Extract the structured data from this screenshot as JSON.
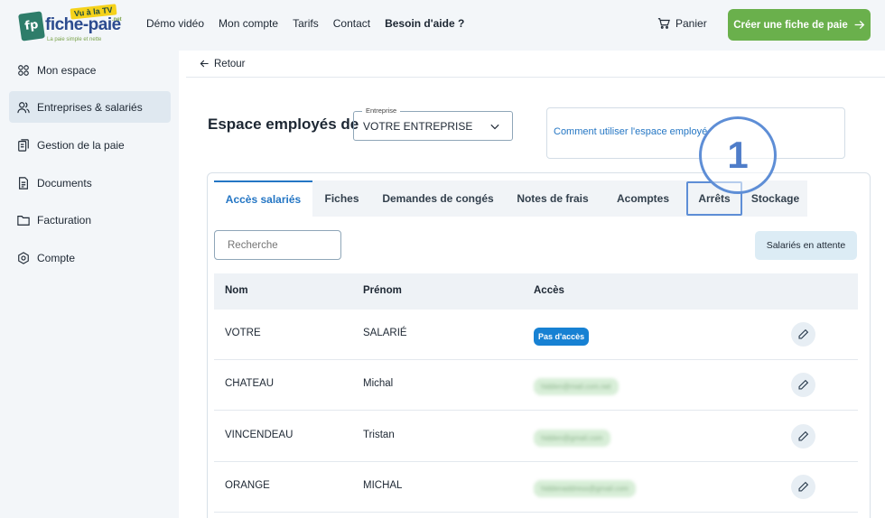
{
  "header": {
    "logo": {
      "brand": "fiche-paie",
      "tv_badge": "Vu à la TV",
      "tagline": "La paie simple et nette",
      "tld": ".net",
      "badge_letters": "fp"
    },
    "nav": [
      "Démo vidéo",
      "Mon compte",
      "Tarifs",
      "Contact",
      "Besoin d'aide ?"
    ],
    "cart_label": "Panier",
    "create_label": "Créer une fiche de paie",
    "accent_color": "#6ab04c"
  },
  "sidebar": {
    "items": [
      {
        "label": "Mon espace",
        "icon": "dashboard-icon"
      },
      {
        "label": "Entreprises & salariés",
        "icon": "users-icon"
      },
      {
        "label": "Gestion de la paie",
        "icon": "payroll-icon"
      },
      {
        "label": "Documents",
        "icon": "document-icon"
      },
      {
        "label": "Facturation",
        "icon": "folder-icon"
      },
      {
        "label": "Compte",
        "icon": "settings-icon"
      }
    ],
    "active": "Entreprises & salariés"
  },
  "main": {
    "back_label": "Retour",
    "title": "Espace employés de",
    "company_select": {
      "legend": "Entreprise",
      "value": "VOTRE ENTREPRISE"
    },
    "help_text": "Comment utiliser l'espace employé",
    "step_marker": "1",
    "tabs": [
      "Accès salariés",
      "Fiches",
      "Demandes de congés",
      "Notes de frais",
      "Acomptes",
      "Arrêts",
      "Stockage"
    ],
    "active_tab": "Accès salariés",
    "highlighted_tab": "Arrêts",
    "search_placeholder": "Recherche",
    "waiting_label": "Salariés en attente",
    "table": {
      "columns": [
        "Nom",
        "Prénom",
        "Accès"
      ],
      "rows": [
        {
          "nom": "VOTRE",
          "prenom": "SALARIÉ",
          "acces": "Pas d'accès"
        },
        {
          "nom": "CHATEAU",
          "prenom": "Michal",
          "acces": "hidden@mail.com.net"
        },
        {
          "nom": "VINCENDEAU",
          "prenom": "Tristan",
          "acces": "hidden@gmail.com"
        },
        {
          "nom": "ORANGE",
          "prenom": "MICHAL",
          "acces": "hiddenaddress@gmail.com"
        }
      ]
    }
  }
}
